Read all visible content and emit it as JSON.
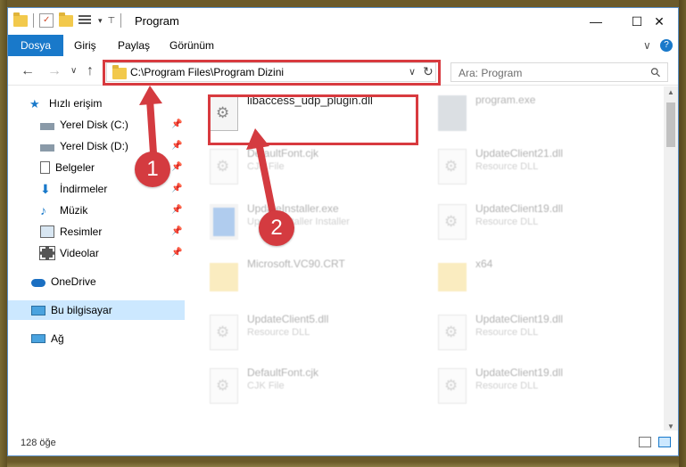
{
  "window": {
    "title": "Program",
    "minimize": "—",
    "maximize": "☐",
    "close": "✕"
  },
  "ribbon": {
    "tabs": [
      "Dosya",
      "Giriş",
      "Paylaş",
      "Görünüm"
    ],
    "collapse": "∨",
    "help": "?"
  },
  "address": {
    "path": "C:\\Program Files\\Program Dizini",
    "dropdown": "∨",
    "refresh": "↻",
    "back": "←",
    "forward": "→",
    "recent": "∨",
    "up": "↑"
  },
  "search": {
    "placeholder": "Ara: Program",
    "icon": "⚲"
  },
  "sidebar": {
    "quick_access": "Hızlı erişim",
    "items": [
      {
        "label": "Yerel Disk (C:)",
        "icon": "drive-icon"
      },
      {
        "label": "Yerel Disk (D:)",
        "icon": "drive-icon"
      },
      {
        "label": "Belgeler",
        "icon": "documents-icon"
      },
      {
        "label": "İndirmeler",
        "icon": "download-icon"
      },
      {
        "label": "Müzik",
        "icon": "music-icon"
      },
      {
        "label": "Resimler",
        "icon": "pictures-icon"
      },
      {
        "label": "Videolar",
        "icon": "videos-icon"
      }
    ],
    "onedrive": "OneDrive",
    "this_pc": "Bu bilgisayar",
    "network": "Ağ"
  },
  "files": [
    {
      "name": "libaccess_udp_plugin.dll",
      "type": ""
    },
    {
      "name": "program.exe",
      "type": ""
    },
    {
      "name": "DefaultFont.cjk",
      "type": "CJK File"
    },
    {
      "name": "UpdateClient21.dll",
      "type": "Resource DLL"
    },
    {
      "name": "UpdateInstaller.exe",
      "type": "Updateinstaller Installer"
    },
    {
      "name": "UpdateClient19.dll",
      "type": "Resource DLL"
    },
    {
      "name": "Microsoft.VC90.CRT",
      "type": ""
    },
    {
      "name": "x64",
      "type": ""
    },
    {
      "name": "UpdateClient5.dll",
      "type": "Resource DLL"
    },
    {
      "name": "UpdateClient19.dll",
      "type": "Resource DLL"
    },
    {
      "name": "DefaultFont.cjk",
      "type": "CJK File"
    },
    {
      "name": "UpdateClient19.dll",
      "type": "Resource DLL"
    }
  ],
  "status": {
    "count": "128 öğe"
  },
  "annotations": {
    "step1": "1",
    "step2": "2"
  },
  "colors": {
    "accent": "#1979ca",
    "highlight": "#d83a3f",
    "selection": "#cce8ff",
    "folder": "#f2c94c"
  }
}
